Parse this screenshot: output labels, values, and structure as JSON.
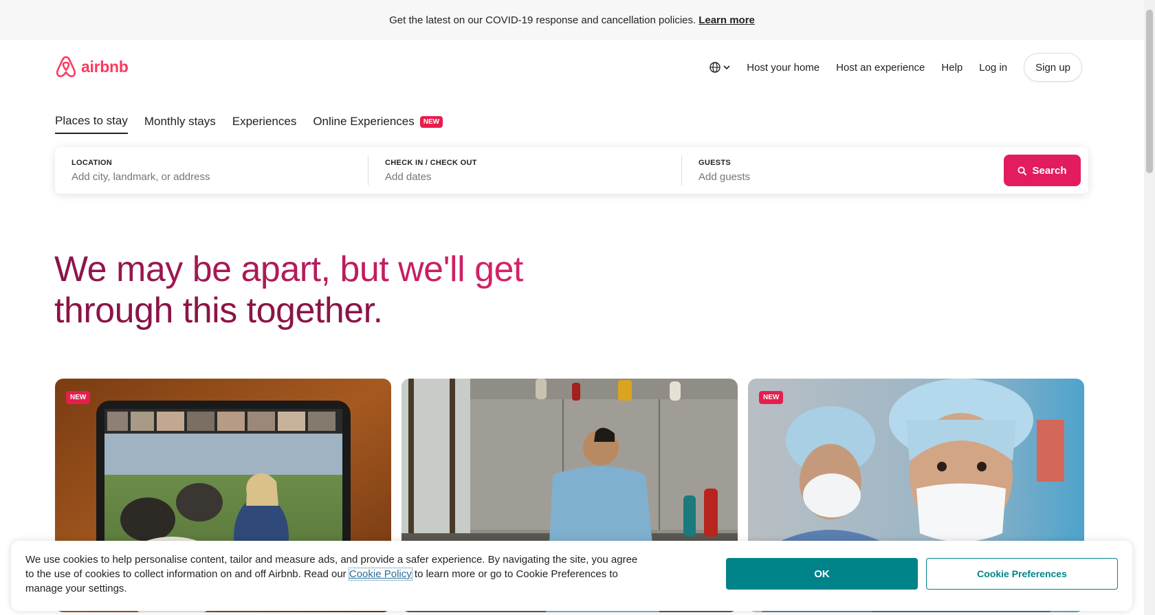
{
  "banner": {
    "text": "Get the latest on our COVID-19 response and cancellation policies.",
    "link": "Learn more"
  },
  "header": {
    "logo_text": "airbnb",
    "nav": [
      "Host your home",
      "Host an experience",
      "Help",
      "Log in"
    ],
    "signup": "Sign up"
  },
  "tabs": [
    {
      "label": "Places to stay",
      "active": true
    },
    {
      "label": "Monthly stays"
    },
    {
      "label": "Experiences"
    },
    {
      "label": "Online Experiences",
      "badge": "NEW"
    }
  ],
  "search": {
    "location_label": "LOCATION",
    "location_placeholder": "Add city, landmark, or address",
    "dates_label": "CHECK IN / CHECK OUT",
    "dates_placeholder": "Add dates",
    "guests_label": "GUESTS",
    "guests_placeholder": "Add guests",
    "button": "Search"
  },
  "hero": {
    "line1": "We may be apart, but we'll get",
    "line2": "through this together."
  },
  "cards": [
    {
      "badge": "NEW"
    },
    {
      "badge": ""
    },
    {
      "badge": "NEW"
    }
  ],
  "cookie": {
    "text_before": "We use cookies to help personalise content, tailor and measure ads, and provide a safer experience. By navigating the site, you agree to the use of cookies to collect information on and off Airbnb. Read our ",
    "link": "Cookie Policy",
    "text_after": " to learn more or go to Cookie Preferences to manage your settings.",
    "ok": "OK",
    "preferences": "Cookie Preferences"
  },
  "colors": {
    "brand": "#ff385c",
    "search_button": "#e31c5f",
    "cookie_ok": "#008489"
  }
}
